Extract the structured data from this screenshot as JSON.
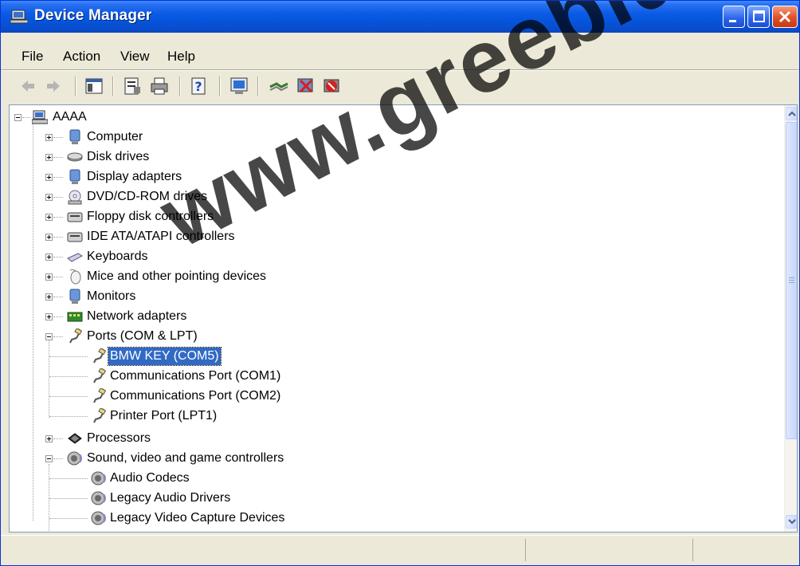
{
  "window": {
    "title": "Device Manager"
  },
  "menu": [
    {
      "label": "File"
    },
    {
      "label": "Action"
    },
    {
      "label": "View"
    },
    {
      "label": "Help"
    }
  ],
  "toolbar": {
    "buttons": [
      "back-arrow-icon",
      "forward-arrow-icon",
      "show-hide-console-tree-icon",
      "properties-icon",
      "print-icon",
      "help-icon",
      "scan-hardware-icon",
      "update-driver-icon",
      "disable-device-icon",
      "uninstall-device-icon"
    ]
  },
  "tree": {
    "root": "AAAA",
    "categories": [
      {
        "label": "Computer",
        "icon": "computer-icon"
      },
      {
        "label": "Disk drives",
        "icon": "disk-drive-icon"
      },
      {
        "label": "Display adapters",
        "icon": "display-adapter-icon"
      },
      {
        "label": "DVD/CD-ROM drives",
        "icon": "dvd-drive-icon"
      },
      {
        "label": "Floppy disk controllers",
        "icon": "floppy-controller-icon"
      },
      {
        "label": "IDE ATA/ATAPI controllers",
        "icon": "ide-controller-icon"
      },
      {
        "label": "Keyboards",
        "icon": "keyboard-icon"
      },
      {
        "label": "Mice and other pointing devices",
        "icon": "mouse-icon"
      },
      {
        "label": "Monitors",
        "icon": "monitor-icon"
      },
      {
        "label": "Network adapters",
        "icon": "network-adapter-icon"
      },
      {
        "label": "Ports (COM & LPT)",
        "icon": "port-icon"
      }
    ],
    "ports": [
      {
        "label": "BMW KEY (COM5)"
      },
      {
        "label": "Communications Port (COM1)"
      },
      {
        "label": "Communications Port (COM2)"
      },
      {
        "label": "Printer Port (LPT1)"
      }
    ],
    "processors": "Processors",
    "sound": "Sound, video and game controllers",
    "sound_children": [
      {
        "label": "Audio Codecs"
      },
      {
        "label": "Legacy Audio Drivers"
      },
      {
        "label": "Legacy Video Capture Devices"
      }
    ]
  },
  "watermark": "www.greebid.co",
  "colors": {
    "title_blue": "#0653d8",
    "selection": "#316ac5",
    "close_red": "#e04f24"
  }
}
